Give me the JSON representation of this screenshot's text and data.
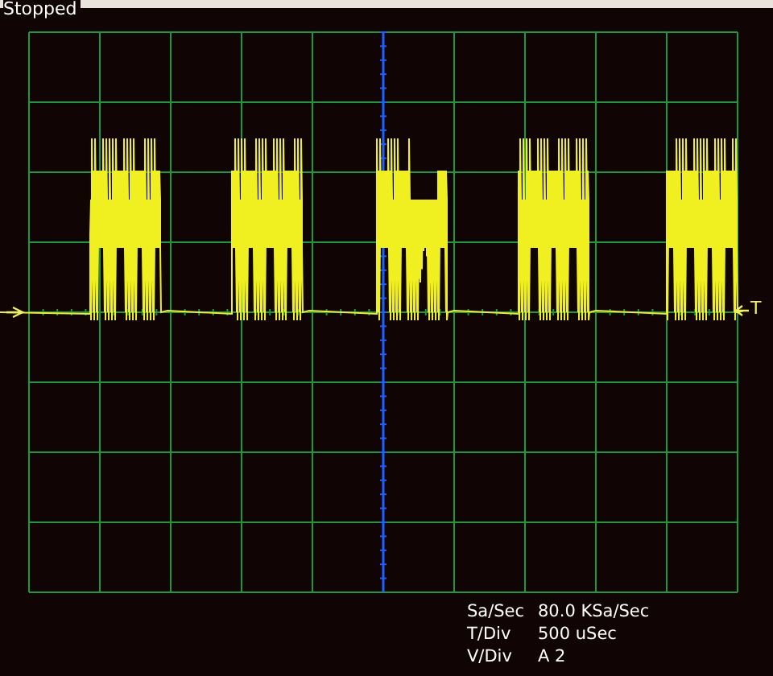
{
  "status": "Stopped",
  "trigger": {
    "label": "T"
  },
  "readouts": [
    {
      "label": "Sa/Sec",
      "value": "80.0 KSa/Sec"
    },
    {
      "label": "T/Div",
      "value": "500 uSec"
    },
    {
      "label": "V/Div",
      "value": "A 2"
    }
  ]
}
